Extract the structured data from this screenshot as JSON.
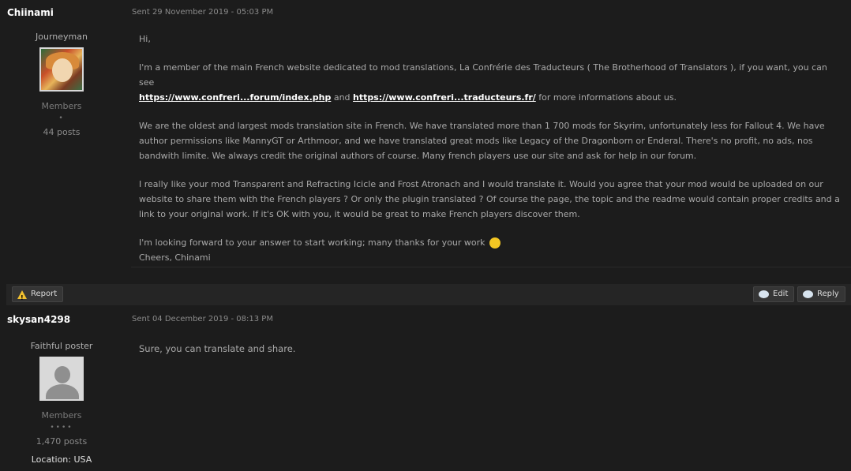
{
  "posts": [
    {
      "author": "Chiinami",
      "date": "Sent 29 November 2019 - 05:03 PM",
      "user_title": "Journeyman",
      "group": "Members",
      "pips": "•",
      "post_count": "44 posts",
      "body": {
        "greeting": "Hi,",
        "p1_text_a": "I'm a member of the main French website dedicated to mod translations, La Confrérie des Traducteurs ( The Brotherhood of Translators ), if you want, you can see",
        "link1": "https://www.confreri...forum/index.php",
        "p1_and": " and ",
        "link2": "https://www.confreri...traducteurs.fr/",
        "p1_text_b": " for more informations about us.",
        "p2": "We are the oldest and largest mods translation site in French. We have translated more than 1 700 mods for Skyrim, unfortunately less for Fallout 4. We have author permissions like MannyGT or Arthmoor, and we have translated great mods like Legacy of the Dragonborn or Enderal. There's no profit, no ads, nos bandwith limite. We always credit the original authors of course. Many french players use our site and ask for help in our forum.",
        "p3": "I really like your mod Transparent and Refracting Icicle and Frost Atronach and I would translate it. Would you agree that your mod would be uploaded on our website to share them with the French players ? Or only the plugin translated ? Of course the page, the topic and the readme would contain proper credits and a link to your original work. If it's OK with you, it would be great to make French players discover them.",
        "p4": "I'm looking forward to your answer to start working; many thanks for your work",
        "signoff": "Cheers, Chinami"
      },
      "actions": {
        "report": "Report",
        "edit": "Edit",
        "reply": "Reply"
      }
    },
    {
      "author": "skysan4298",
      "date": "Sent 04 December 2019 - 08:13 PM",
      "user_title": "Faithful poster",
      "group": "Members",
      "pips": "••••",
      "post_count": "1,470 posts",
      "location": "Location: USA",
      "body": {
        "text": "Sure, you can translate and share."
      }
    }
  ],
  "colors": {
    "background": "#1c1c1c",
    "action_bar": "#252525",
    "link": "#ffffff",
    "warning": "#f0c030"
  },
  "icons": {
    "report": "warning-icon",
    "edit": "speech-bubble-icon",
    "reply": "speech-bubble-icon",
    "wink": "wink-emoji-icon"
  }
}
